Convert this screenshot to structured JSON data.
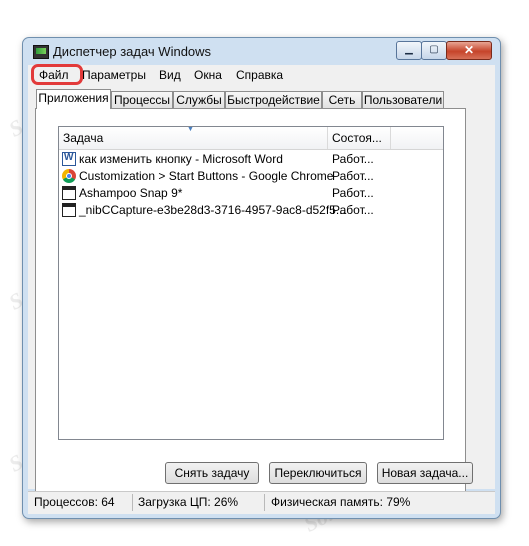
{
  "window": {
    "title": "Диспетчер задач Windows",
    "controls": {
      "minimize": "▁",
      "maximize": "▢",
      "close": "✕"
    }
  },
  "menu": {
    "items": [
      "Файл",
      "Параметры",
      "Вид",
      "Окна",
      "Справка"
    ]
  },
  "tabs": [
    "Приложения",
    "Процессы",
    "Службы",
    "Быстродействие",
    "Сеть",
    "Пользователи"
  ],
  "active_tab": "Приложения",
  "table": {
    "columns": [
      "Задача",
      "Состоя..."
    ],
    "rows": [
      {
        "icon": "word-icon",
        "task": "как изменить кнопку - Microsoft Word",
        "status": "Работ..."
      },
      {
        "icon": "chrome-icon",
        "task": "Customization > Start Buttons - Google Chrome",
        "status": "Работ..."
      },
      {
        "icon": "window-icon",
        "task": "Ashampoo Snap 9*",
        "status": "Работ..."
      },
      {
        "icon": "window-icon",
        "task": "_nibCCapture-e3be28d3-3716-4957-9ac8-d52f5...",
        "status": "Работ..."
      }
    ]
  },
  "buttons": {
    "end_task": "Снять задачу",
    "switch_to": "Переключиться",
    "new_task": "Новая задача..."
  },
  "status": {
    "processes": "Процессов: 64",
    "cpu": "Загрузка ЦП: 26%",
    "memory": "Физическая память: 79%"
  },
  "watermark": "Soringpcrepair.Com",
  "colors": {
    "highlight": "#e23a3a",
    "frame": "#cfe0f1",
    "close_button": "#c6442a"
  }
}
